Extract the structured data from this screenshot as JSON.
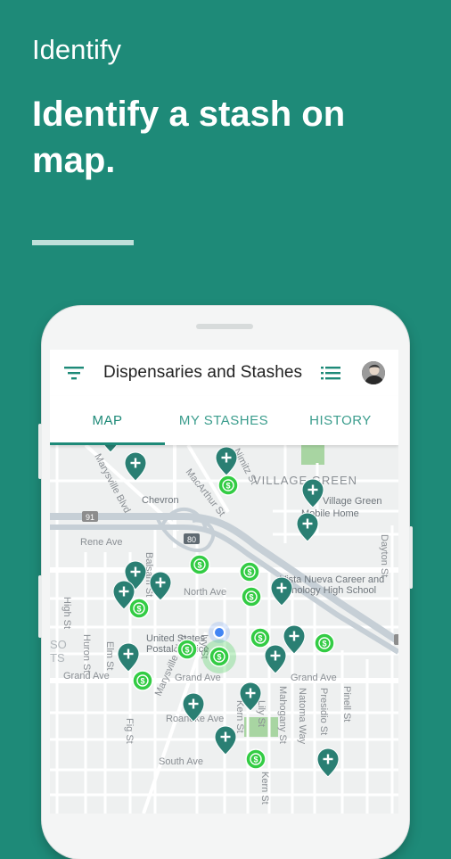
{
  "promo": {
    "eyebrow": "Identify",
    "headline": "Identify a stash on map."
  },
  "appbar": {
    "title": "Dispensaries and Stashes",
    "icons": [
      "filter-icon",
      "list-icon",
      "avatar"
    ]
  },
  "tabs": [
    {
      "label": "MAP",
      "selected": true
    },
    {
      "label": "MY STASHES",
      "selected": false
    },
    {
      "label": "HISTORY",
      "selected": false
    }
  ],
  "map": {
    "labels": {
      "village_green": "VILLAGE GREEN",
      "village_green_school_1": "Village Green",
      "village_green_school_2": "Mobile Home",
      "chevron": "Chevron",
      "rene_ave": "Rene Ave",
      "north_ave": "North Ave",
      "grand_ave_left": "Grand Ave",
      "grand_ave_mid": "Grand Ave",
      "grand_ave_right": "Grand Ave",
      "roanoke_ave": "Roanoke Ave",
      "south_ave": "South Ave",
      "marysville_blvd_top": "Marysville Blvd",
      "marysville_blvd_bottom": "Marysville Blvd",
      "macarthur_st": "MacArthur St",
      "nimitz_st": "Nimitz St",
      "balsam_st": "Balsam St",
      "high_st": "High St",
      "huron_st": "Huron St",
      "elm_st": "Elm St",
      "fig_st": "Fig St",
      "ivy_st": "Ivy St",
      "kern_st": "Kern St",
      "lily_st": "Lily St",
      "mahogany_st": "Mahogany St",
      "natoma_way": "Natoma Way",
      "presidio_st": "Presidio St",
      "pinell_st": "Pinell St",
      "dayton_st": "Dayton St",
      "school_1": "Vista Nueva Career and",
      "school_2": "Technology High School",
      "post_office_1": "United States",
      "post_office_2": "Postal Service",
      "route_91": "91",
      "route_80": "80",
      "corner_1": "SO",
      "corner_2": "TS"
    },
    "pin_icon": "plus-marker-icon",
    "stash_icon": "dollar-marker-icon",
    "colors": {
      "pin": "#2a7f73",
      "stash": "#33cc44",
      "location": "#4285f4",
      "highway": "#c6cfd6"
    }
  }
}
